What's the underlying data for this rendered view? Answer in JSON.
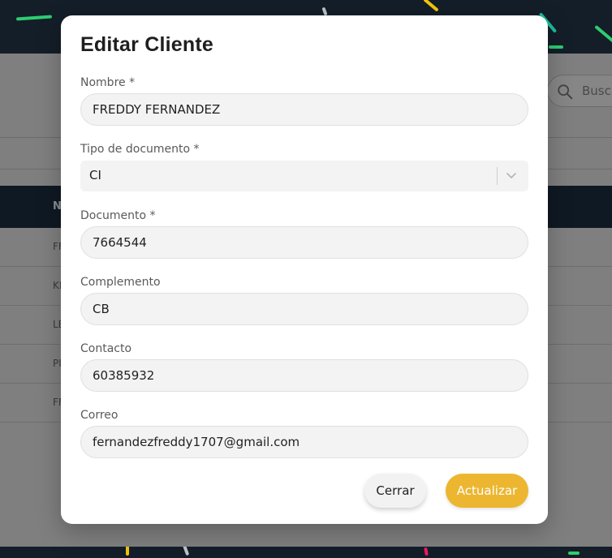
{
  "background": {
    "search_placeholder": "Busca",
    "table_header_col": "N",
    "rows": [
      "FF",
      "KI",
      "LE",
      "PI",
      "FF"
    ]
  },
  "modal": {
    "title": "Editar Cliente",
    "fields": {
      "nombre": {
        "label": "Nombre *",
        "value": "FREDDY FERNANDEZ"
      },
      "tipo_documento": {
        "label": "Tipo de documento *",
        "value": "CI"
      },
      "documento": {
        "label": "Documento *",
        "value": "7664544"
      },
      "complemento": {
        "label": "Complemento",
        "value": "CB"
      },
      "contacto": {
        "label": "Contacto",
        "value": "60385932"
      },
      "correo": {
        "label": "Correo",
        "value": "fernandezfreddy1707@gmail.com"
      }
    },
    "buttons": {
      "close": "Cerrar",
      "update": "Actualizar"
    }
  },
  "colors": {
    "accent": "#ecb630",
    "header_dark": "#141e28"
  },
  "icons": {
    "search": "search-icon",
    "select_chevron": "chevron-down-icon"
  }
}
